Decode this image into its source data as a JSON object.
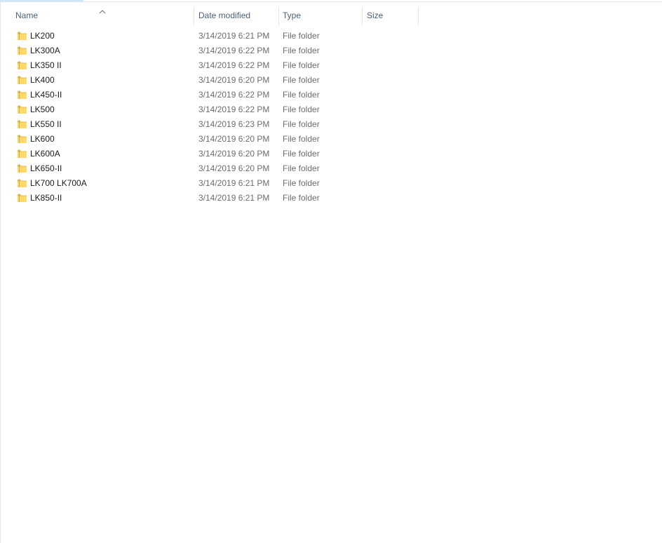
{
  "columns": {
    "name": "Name",
    "date_modified": "Date modified",
    "type": "Type",
    "size": "Size"
  },
  "sort": {
    "column": "Name",
    "direction": "ascending",
    "icon": "sort-up-caret"
  },
  "items": [
    {
      "name": "LK200",
      "date_modified": "3/14/2019 6:21 PM",
      "type": "File folder",
      "size": "",
      "icon": "folder-icon"
    },
    {
      "name": "LK300A",
      "date_modified": "3/14/2019 6:22 PM",
      "type": "File folder",
      "size": "",
      "icon": "folder-icon"
    },
    {
      "name": "LK350 II",
      "date_modified": "3/14/2019 6:22 PM",
      "type": "File folder",
      "size": "",
      "icon": "folder-icon"
    },
    {
      "name": "LK400",
      "date_modified": "3/14/2019 6:20 PM",
      "type": "File folder",
      "size": "",
      "icon": "folder-icon"
    },
    {
      "name": "LK450-II",
      "date_modified": "3/14/2019 6:22 PM",
      "type": "File folder",
      "size": "",
      "icon": "folder-icon"
    },
    {
      "name": "LK500",
      "date_modified": "3/14/2019 6:22 PM",
      "type": "File folder",
      "size": "",
      "icon": "folder-icon"
    },
    {
      "name": "LK550 II",
      "date_modified": "3/14/2019 6:23 PM",
      "type": "File folder",
      "size": "",
      "icon": "folder-icon"
    },
    {
      "name": "LK600",
      "date_modified": "3/14/2019 6:20 PM",
      "type": "File folder",
      "size": "",
      "icon": "folder-icon"
    },
    {
      "name": "LK600A",
      "date_modified": "3/14/2019 6:20 PM",
      "type": "File folder",
      "size": "",
      "icon": "folder-icon"
    },
    {
      "name": "LK650-II",
      "date_modified": "3/14/2019 6:20 PM",
      "type": "File folder",
      "size": "",
      "icon": "folder-icon"
    },
    {
      "name": "LK700 LK700A",
      "date_modified": "3/14/2019 6:21 PM",
      "type": "File folder",
      "size": "",
      "icon": "folder-icon"
    },
    {
      "name": "LK850-II",
      "date_modified": "3/14/2019 6:21 PM",
      "type": "File folder",
      "size": "",
      "icon": "folder-icon"
    }
  ],
  "colors": {
    "header_text": "#4c607a",
    "name_text": "#1b1b1b",
    "detail_text": "#6d6d6d",
    "folder_fill": "#ffd96b",
    "folder_tab": "#e8b94a",
    "divider": "#e5e5e5"
  }
}
